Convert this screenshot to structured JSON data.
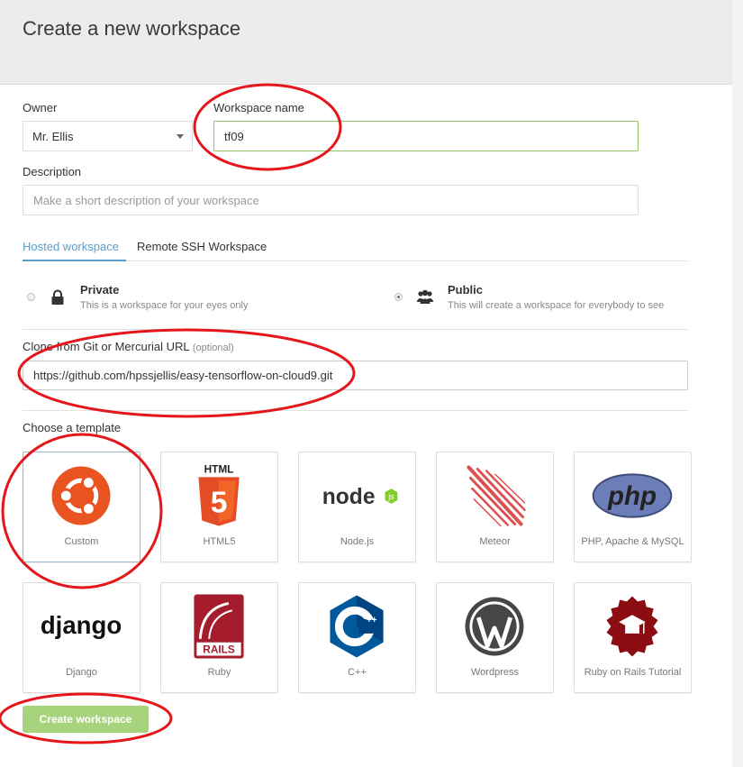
{
  "header": {
    "title": "Create a new workspace"
  },
  "form": {
    "owner_label": "Owner",
    "owner_value": "Mr. Ellis",
    "workspace_name_label": "Workspace name",
    "workspace_name_value": "tf09",
    "description_label": "Description",
    "description_placeholder": "Make a short description of your workspace",
    "clone_label": "Clone from Git or Mercurial URL",
    "clone_optional": "(optional)",
    "clone_value": "https://github.com/hpssjellis/easy-tensorflow-on-cloud9.git",
    "template_label": "Choose a template"
  },
  "tabs": [
    {
      "label": "Hosted workspace",
      "active": true
    },
    {
      "label": "Remote SSH Workspace",
      "active": false
    }
  ],
  "visibility": [
    {
      "title": "Private",
      "desc": "This is a workspace for your eyes only",
      "selected": false
    },
    {
      "title": "Public",
      "desc": "This will create a workspace for everybody to see",
      "selected": true
    }
  ],
  "templates": [
    {
      "name": "Custom",
      "icon": "ubuntu-icon",
      "selected": true
    },
    {
      "name": "HTML5",
      "icon": "html5-icon"
    },
    {
      "name": "Node.js",
      "icon": "nodejs-icon"
    },
    {
      "name": "Meteor",
      "icon": "meteor-icon"
    },
    {
      "name": "PHP, Apache & MySQL",
      "icon": "php-icon"
    },
    {
      "name": "Django",
      "icon": "django-icon"
    },
    {
      "name": "Ruby",
      "icon": "rails-icon"
    },
    {
      "name": "C++",
      "icon": "cpp-icon"
    },
    {
      "name": "Wordpress",
      "icon": "wordpress-icon"
    },
    {
      "name": "Ruby on Rails Tutorial",
      "icon": "rails-tutorial-icon"
    }
  ],
  "logo_text": {
    "html5": "HTML",
    "html5_digit": "5",
    "node": "node",
    "node_js": "js",
    "php": "php",
    "django": "django",
    "rails": "RAILS",
    "cpp": "C",
    "cpp_plus": "++"
  },
  "create_button": "Create workspace",
  "colors": {
    "accent_blue": "#5b9dc9",
    "focus_green": "#8cc665",
    "button_green": "#a6d37c",
    "annotation_red": "#e4161b"
  }
}
